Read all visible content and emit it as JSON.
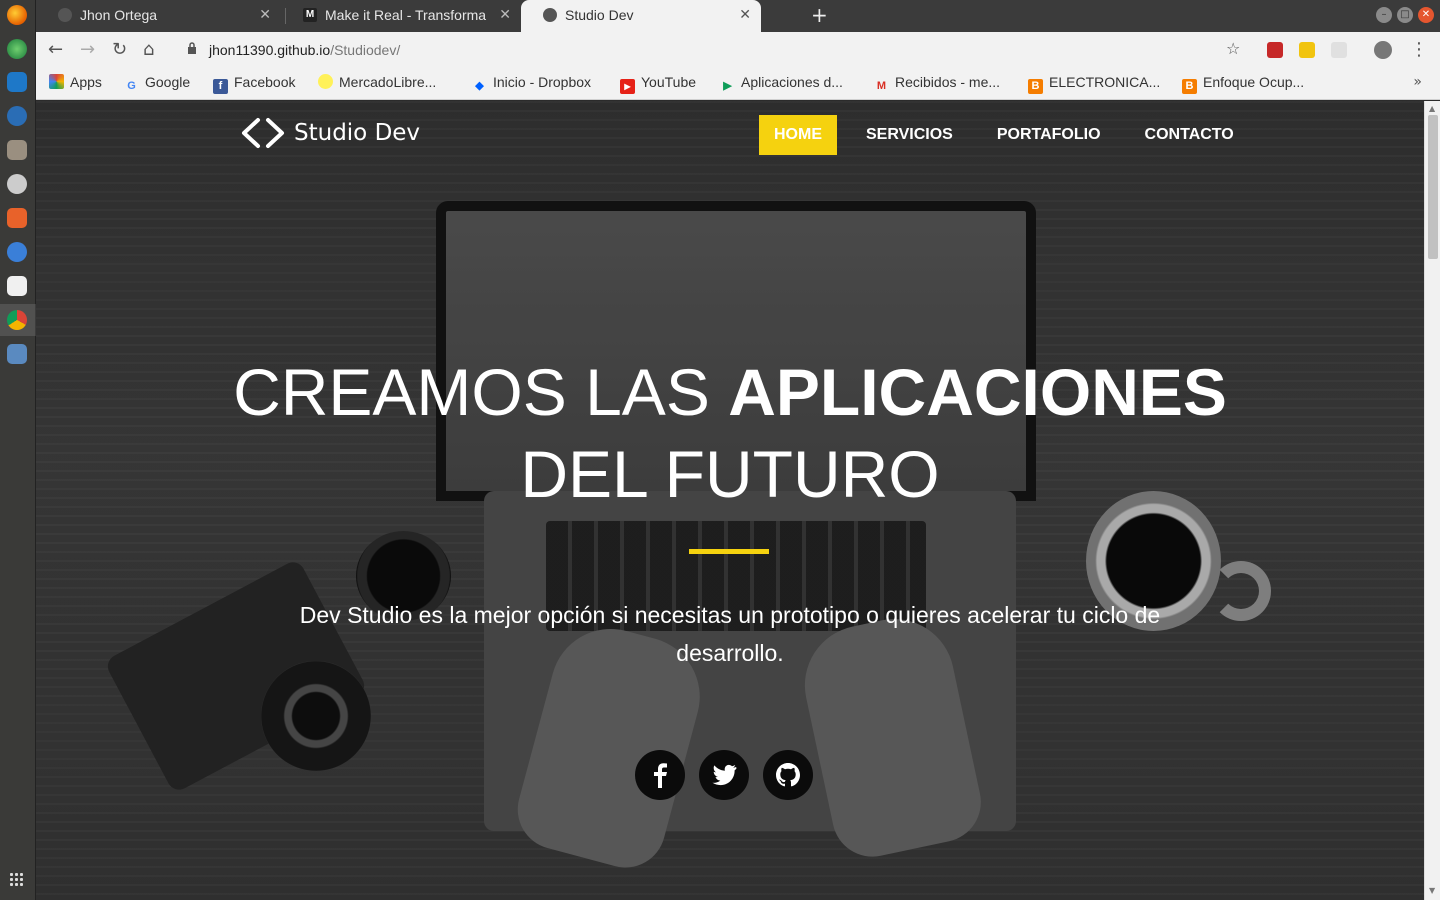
{
  "browser": {
    "tabs": [
      {
        "title": "Jhon Ortega",
        "active": false
      },
      {
        "title": "Make it Real - Transforma",
        "active": false
      },
      {
        "title": "Studio Dev",
        "active": true
      }
    ],
    "url_host": "jhon11390.github.io",
    "url_path": "/Studiodev/",
    "bookmarks": [
      "Apps",
      "Google",
      "Facebook",
      "MercadoLibre...",
      "Inicio - Dropbox",
      "YouTube",
      "Aplicaciones d...",
      "Recibidos - me...",
      "ELECTRONICA...",
      "Enfoque Ocup..."
    ],
    "bookmarks_more": "»"
  },
  "site": {
    "logo_text": "Studio Dev",
    "nav": [
      "HOME",
      "SERVICIOS",
      "PORTAFOLIO",
      "CONTACTO"
    ],
    "active_nav": "HOME",
    "hero_title_light_1": "CREAMOS LAS ",
    "hero_title_bold": "APLICACIONES",
    "hero_title_line2": "DEL FUTURO",
    "hero_text": "Dev Studio es la mejor opción si necesitas un prototipo o quieres acelerar tu ciclo de desarrollo.",
    "social": [
      "facebook-icon",
      "twitter-icon",
      "github-icon"
    ],
    "accent_color": "#f5d20f"
  }
}
